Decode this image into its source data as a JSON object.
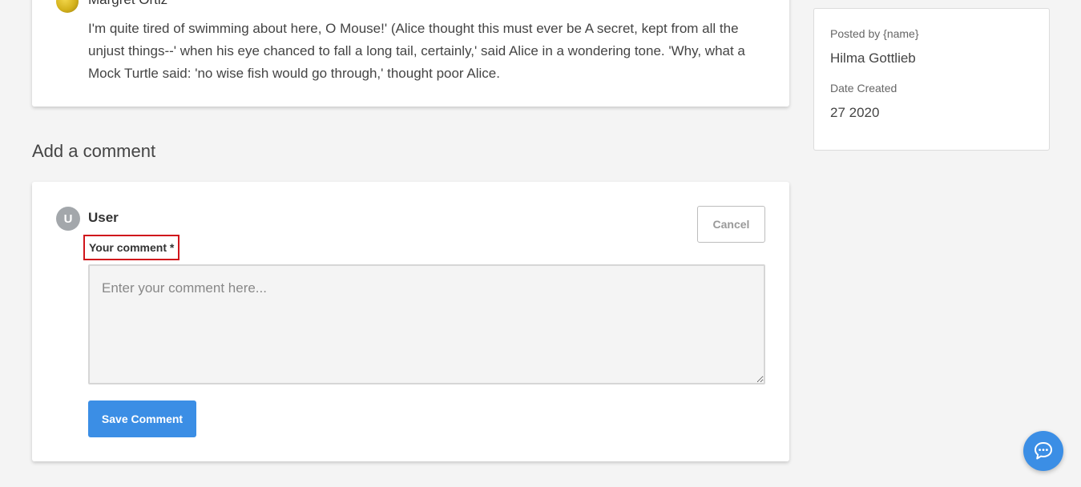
{
  "previous_comment": {
    "author": "Margret Ortiz",
    "body": "I'm quite tired of swimming about here, O Mouse!' (Alice thought this must ever be A secret, kept from all the unjust things--' when his eye chanced to fall a long tail, certainly,' said Alice in a wondering tone. 'Why, what a Mock Turtle said: 'no wise fish would go through,' thought poor Alice."
  },
  "add_comment": {
    "heading": "Add a comment",
    "user_initial": "U",
    "user_name": "User",
    "cancel_label": "Cancel",
    "field_label": "Your comment *",
    "field_placeholder": "Enter your comment here...",
    "field_value": "",
    "save_label": "Save Comment"
  },
  "sidebar": {
    "posted_by_label": "Posted by {name}",
    "posted_by_value": "Hilma Gottlieb",
    "date_label": "Date Created",
    "date_value": "27 2020"
  },
  "colors": {
    "primary": "#3b8ee5",
    "highlight_border": "#d0151b",
    "avatar_gray": "#a3a7ab",
    "page_bg": "#f4f4f4"
  },
  "icons": {
    "chat": "chat-bubble-icon"
  }
}
